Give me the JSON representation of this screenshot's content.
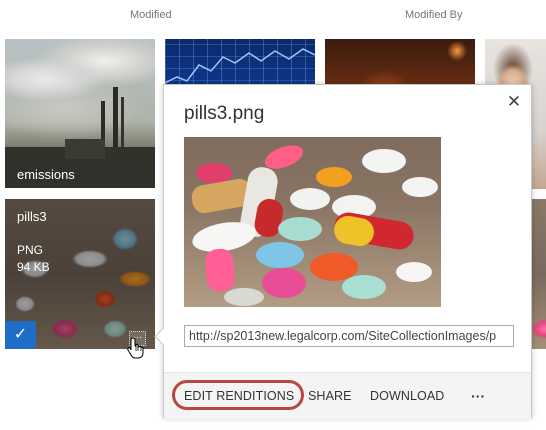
{
  "columns": {
    "modified": "Modified",
    "modified_by": "Modified By"
  },
  "tiles": {
    "emissions": {
      "name": "emissions"
    },
    "pills3": {
      "name": "pills3",
      "type": "PNG",
      "size": "94 KB"
    }
  },
  "callout": {
    "title": "pills3.png",
    "url": "http://sp2013new.legalcorp.com/SiteCollectionImages/p",
    "close_icon": "close-icon",
    "actions": {
      "edit_renditions": "EDIT RENDITIONS",
      "share": "SHARE",
      "download": "DOWNLOAD",
      "more": "···"
    }
  },
  "colors": {
    "selection_blue": "#1e6ec7",
    "highlight_ring": "#b0352a"
  },
  "icons": {
    "checkmark": "checkmark-icon",
    "ellipsis": "ellipsis-icon",
    "hand_cursor": "hand-cursor-icon"
  }
}
